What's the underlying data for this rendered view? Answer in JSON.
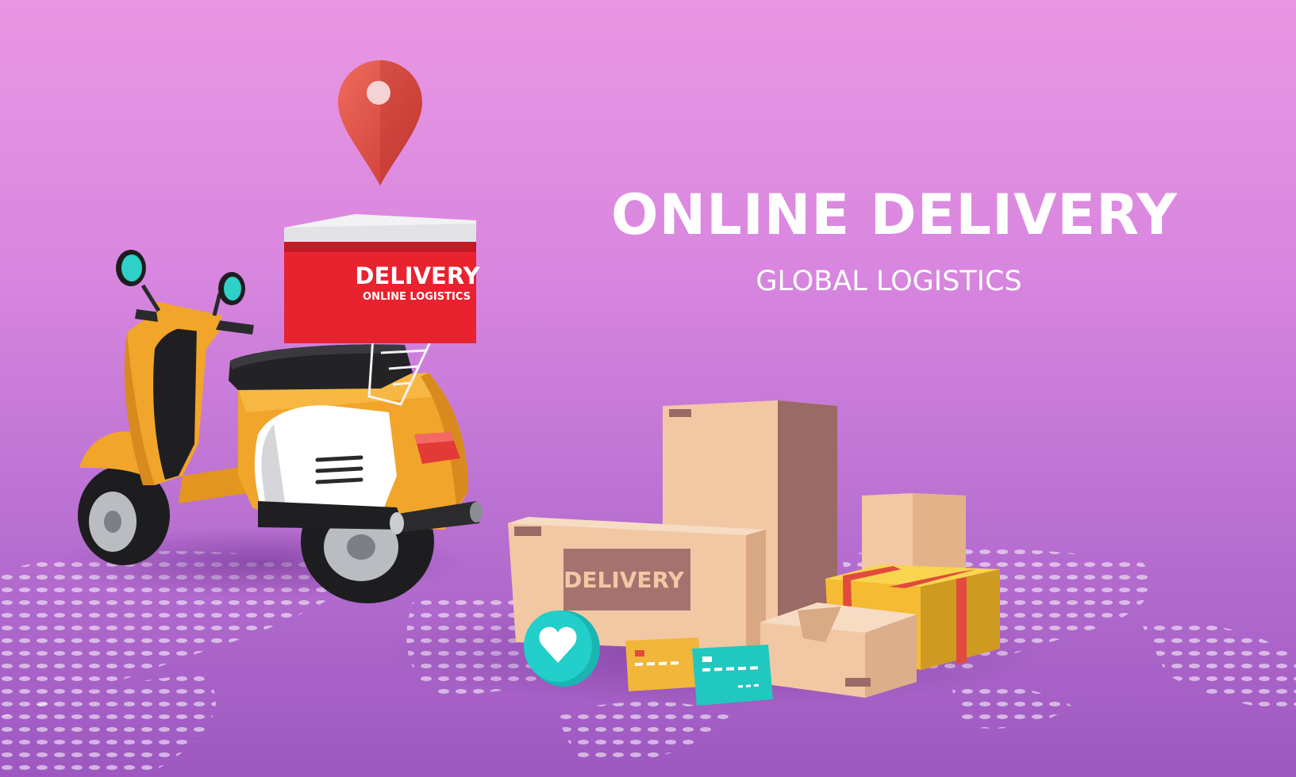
{
  "banner": {
    "title": "ONLINE DELIVERY",
    "subtitle": "GLOBAL LOGISTICS"
  },
  "scooter_box": {
    "label_main": "DELIVERY",
    "label_sub": "ONLINE LOGISTICS"
  },
  "parcel": {
    "label": "DELIVERY"
  },
  "icons": [
    "location-pin-icon",
    "heart-icon",
    "credit-card-icon"
  ],
  "colors": {
    "background_top": "#e997e3",
    "background_bottom": "#9d58c0",
    "pin_red": "#e2524f",
    "delivery_box_red": "#e8222f",
    "scooter_orange": "#f1a52a",
    "cardboard": "#f2c8a4",
    "heart_badge_teal": "#1ec9c4"
  }
}
